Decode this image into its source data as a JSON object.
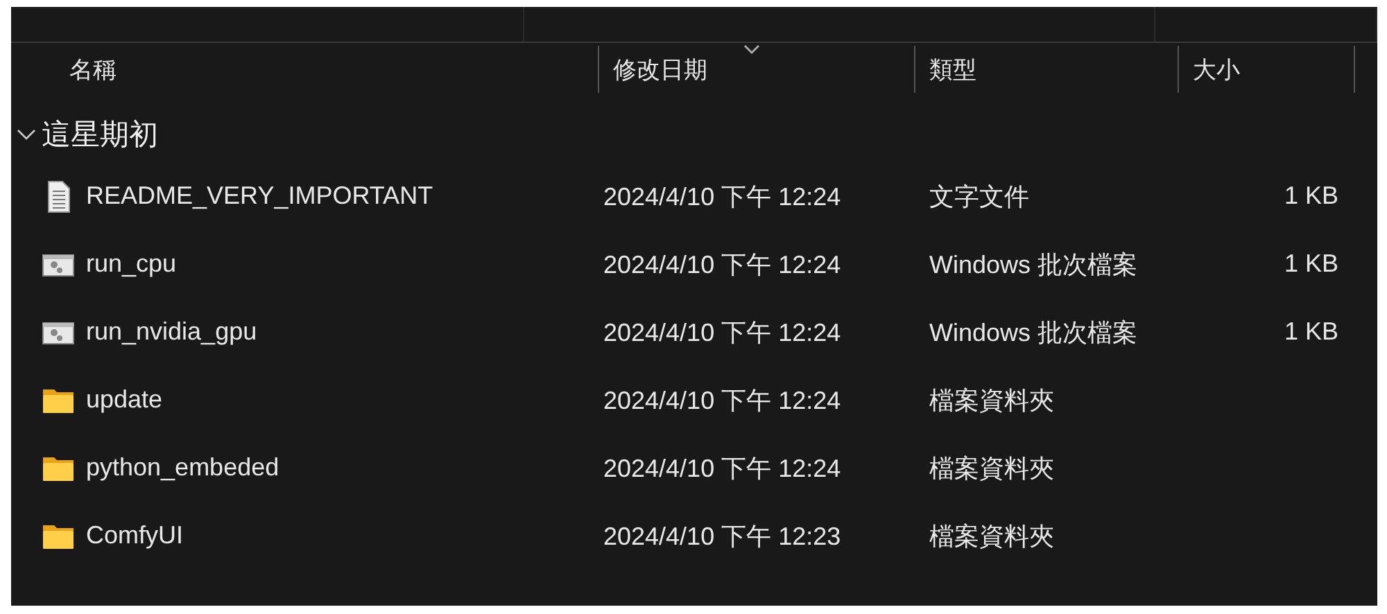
{
  "columns": [
    {
      "label": "名稱",
      "sorted": false
    },
    {
      "label": "修改日期",
      "sorted": true
    },
    {
      "label": "類型",
      "sorted": false
    },
    {
      "label": "大小",
      "sorted": false
    }
  ],
  "group": {
    "label": "這星期初",
    "expanded": true,
    "files": [
      {
        "name": "README_VERY_IMPORTANT",
        "kind": "text",
        "date": "2024/4/10 下午 12:24",
        "type": "文字文件",
        "size": "1 KB"
      },
      {
        "name": "run_cpu",
        "kind": "batch",
        "date": "2024/4/10 下午 12:24",
        "type": "Windows 批次檔案",
        "size": "1 KB"
      },
      {
        "name": "run_nvidia_gpu",
        "kind": "batch",
        "date": "2024/4/10 下午 12:24",
        "type": "Windows 批次檔案",
        "size": "1 KB"
      },
      {
        "name": "update",
        "kind": "folder",
        "date": "2024/4/10 下午 12:24",
        "type": "檔案資料夾"
      },
      {
        "name": "python_embeded",
        "kind": "folder",
        "date": "2024/4/10 下午 12:24",
        "type": "檔案資料夾"
      },
      {
        "name": "ComfyUI",
        "kind": "folder",
        "date": "2024/4/10 下午 12:23",
        "type": "檔案資料夾"
      }
    ]
  }
}
